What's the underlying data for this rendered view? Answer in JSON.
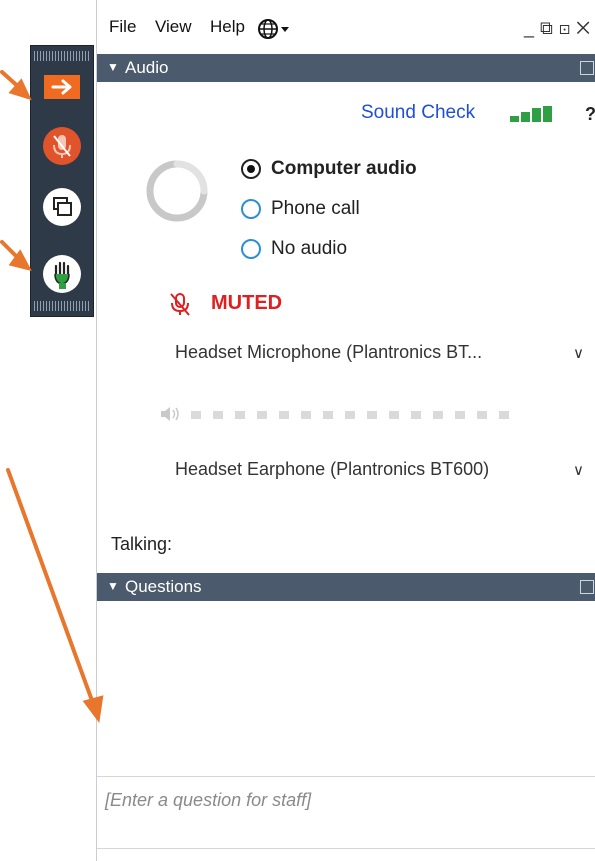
{
  "menu": {
    "file": "File",
    "view": "View",
    "help": "Help"
  },
  "window_controls": {
    "minimize": "_",
    "restore": "⧉",
    "popout": "⊡",
    "close": "✕"
  },
  "audio": {
    "header": "Audio",
    "sound_check": "Sound Check",
    "help": "?",
    "options": [
      {
        "label": "Computer audio",
        "selected": true
      },
      {
        "label": "Phone call",
        "selected": false
      },
      {
        "label": "No audio",
        "selected": false
      }
    ],
    "muted_label": "MUTED",
    "microphone": "Headset Microphone (Plantronics BT...",
    "speaker": "Headset Earphone (Plantronics BT600)",
    "talking_label": "Talking:"
  },
  "questions": {
    "header": "Questions",
    "placeholder": "[Enter a question for staff]"
  },
  "colors": {
    "header_bg": "#4b5a6c",
    "accent_orange": "#f06a20",
    "muted_red": "#e02020",
    "link_blue": "#1f4fd8",
    "signal_green": "#2ea043"
  }
}
